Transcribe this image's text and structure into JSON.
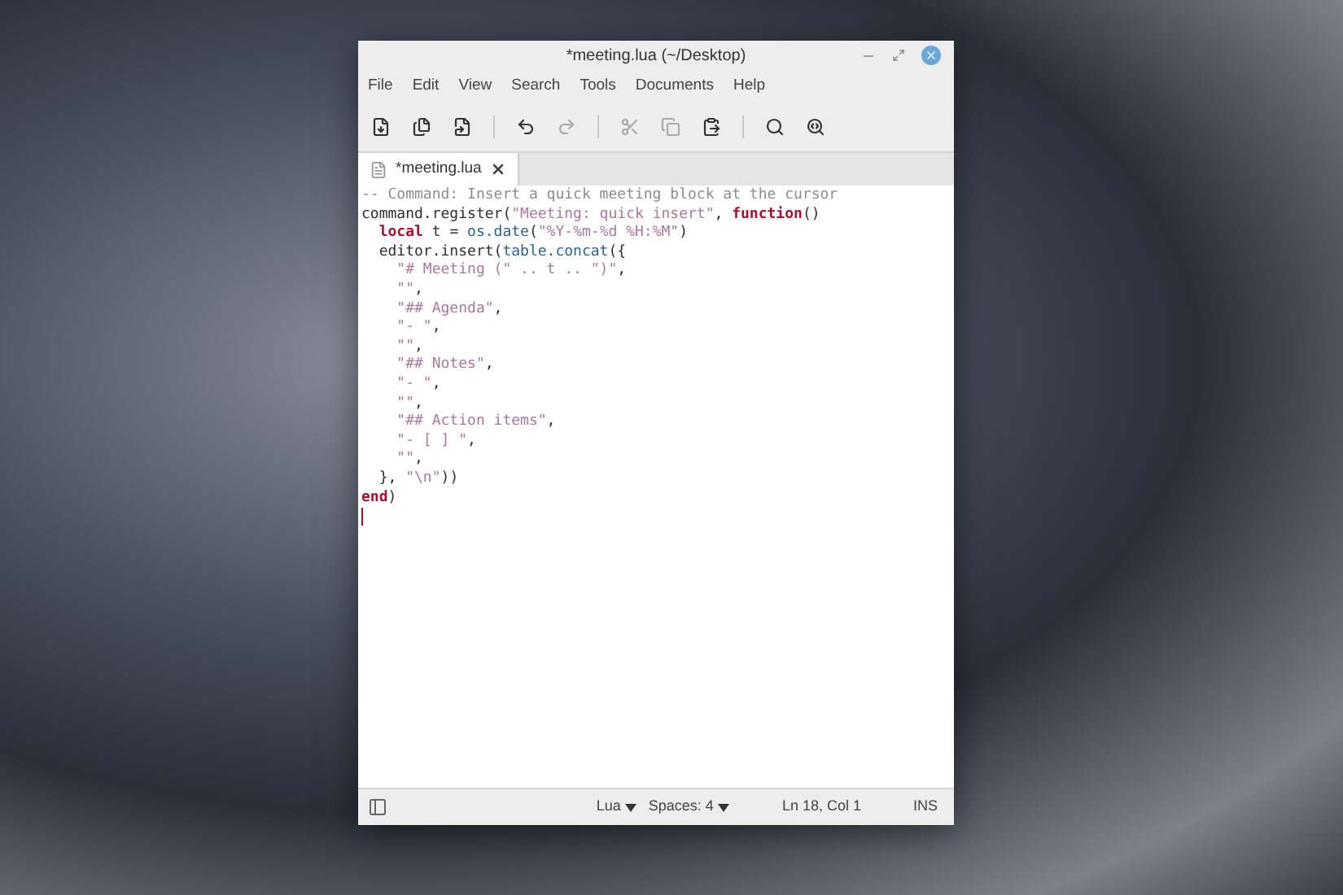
{
  "window": {
    "title": "*meeting.lua (~/Desktop)"
  },
  "menu": [
    "File",
    "Edit",
    "View",
    "Search",
    "Tools",
    "Documents",
    "Help"
  ],
  "toolbar": [
    {
      "kind": "new",
      "disabled": false
    },
    {
      "kind": "open",
      "disabled": false
    },
    {
      "kind": "save",
      "disabled": false
    },
    {
      "kind": "sep"
    },
    {
      "kind": "undo",
      "disabled": false
    },
    {
      "kind": "redo",
      "disabled": true
    },
    {
      "kind": "sep"
    },
    {
      "kind": "cut",
      "disabled": true
    },
    {
      "kind": "copy",
      "disabled": true
    },
    {
      "kind": "paste",
      "disabled": false
    },
    {
      "kind": "sep"
    },
    {
      "kind": "find",
      "disabled": false
    },
    {
      "kind": "replace",
      "disabled": false
    }
  ],
  "tabs": [
    {
      "label": "*meeting.lua",
      "selected": true
    }
  ],
  "code": [
    [
      {
        "kind": "comment",
        "text": "-- Command: Insert a quick meeting block at the cursor"
      }
    ],
    [
      {
        "kind": "plain",
        "text": "command.register("
      },
      {
        "kind": "string",
        "text": "\"Meeting: quick insert\""
      },
      {
        "kind": "plain",
        "text": ", "
      },
      {
        "kind": "keyword",
        "text": "function"
      },
      {
        "kind": "plain",
        "text": "()"
      }
    ],
    [
      {
        "kind": "keyword",
        "text": "  local"
      },
      {
        "kind": "plain",
        "text": " t = "
      },
      {
        "kind": "builtin",
        "text": "os.date"
      },
      {
        "kind": "plain",
        "text": "("
      },
      {
        "kind": "string",
        "text": "\"%Y-%m-%d %H:%M\""
      },
      {
        "kind": "plain",
        "text": ")"
      }
    ],
    [
      {
        "kind": "plain",
        "text": "  editor.insert("
      },
      {
        "kind": "builtin",
        "text": "table.concat"
      },
      {
        "kind": "plain",
        "text": "({"
      }
    ],
    [
      {
        "kind": "string",
        "text": "    \"# Meeting (\" .. t .. \")\""
      },
      {
        "kind": "plain",
        "text": ","
      }
    ],
    [
      {
        "kind": "string",
        "text": "    \"\""
      },
      {
        "kind": "plain",
        "text": ","
      }
    ],
    [
      {
        "kind": "string",
        "text": "    \"## Agenda\""
      },
      {
        "kind": "plain",
        "text": ","
      }
    ],
    [
      {
        "kind": "string",
        "text": "    \"- \""
      },
      {
        "kind": "plain",
        "text": ","
      }
    ],
    [
      {
        "kind": "string",
        "text": "    \"\""
      },
      {
        "kind": "plain",
        "text": ","
      }
    ],
    [
      {
        "kind": "string",
        "text": "    \"## Notes\""
      },
      {
        "kind": "plain",
        "text": ","
      }
    ],
    [
      {
        "kind": "string",
        "text": "    \"- \""
      },
      {
        "kind": "plain",
        "text": ","
      }
    ],
    [
      {
        "kind": "string",
        "text": "    \"\""
      },
      {
        "kind": "plain",
        "text": ","
      }
    ],
    [
      {
        "kind": "string",
        "text": "    \"## Action items\""
      },
      {
        "kind": "plain",
        "text": ","
      }
    ],
    [
      {
        "kind": "string",
        "text": "    \"- [ ] \""
      },
      {
        "kind": "plain",
        "text": ","
      }
    ],
    [
      {
        "kind": "string",
        "text": "    \"\""
      },
      {
        "kind": "plain",
        "text": ","
      }
    ],
    [
      {
        "kind": "plain",
        "text": "  }, "
      },
      {
        "kind": "string",
        "text": "\"\\n\""
      },
      {
        "kind": "plain",
        "text": "))"
      }
    ],
    [
      {
        "kind": "keyword",
        "text": "end"
      },
      {
        "kind": "plain",
        "text": ")"
      }
    ]
  ],
  "status_bar": {
    "language": "Lua",
    "indent": "Spaces: 4",
    "position": "Ln 18, Col 1",
    "mode": "INS"
  }
}
